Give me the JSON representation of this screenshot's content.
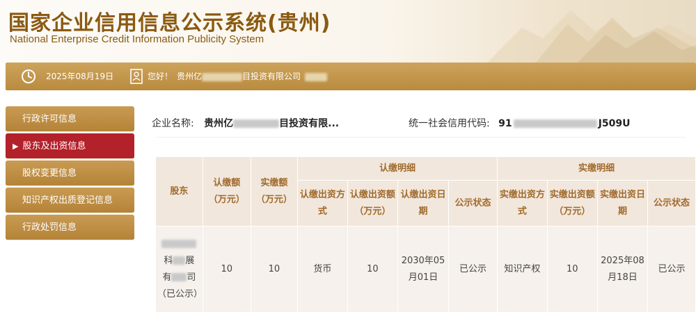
{
  "header": {
    "title_cn": "国家企业信用信息公示系统(贵州)",
    "title_en": "National Enterprise Credit Information Publicity System"
  },
  "infobar": {
    "date": "2025年08月19日",
    "greeting": "您好！",
    "company_prefix": "贵州亿",
    "company_suffix": "目投资有限公司"
  },
  "sidebar": {
    "items": [
      {
        "label": "行政许可信息",
        "active": false
      },
      {
        "label": "股东及出资信息",
        "active": true
      },
      {
        "label": "股权变更信息",
        "active": false
      },
      {
        "label": "知识产权出质登记信息",
        "active": false
      },
      {
        "label": "行政处罚信息",
        "active": false
      }
    ],
    "active_marker": "▶"
  },
  "enterprise": {
    "name_label": "企业名称:",
    "name_prefix": "贵州亿",
    "name_suffix": "目投资有限...",
    "code_label": "统一社会信用代码:",
    "code_prefix": "91",
    "code_suffix": "J509U"
  },
  "table": {
    "headers": {
      "shareholder": "股东",
      "subscribed_amount": "认缴额（万元）",
      "paid_amount": "实缴额（万元）",
      "subscribed_detail": "认缴明细",
      "paid_detail": "实缴明细",
      "sub_method": "认缴出资方式",
      "sub_amount": "认缴出资额（万元）",
      "sub_date": "认缴出资日期",
      "sub_status": "公示状态",
      "paid_method": "实缴出资方式",
      "paid_amt": "实缴出资额（万元）",
      "paid_date": "实缴出资日期",
      "paid_status": "公示状态"
    },
    "row": {
      "shareholder_a": "科",
      "shareholder_b": "展",
      "shareholder_c": "有",
      "shareholder_d": "司",
      "shareholder_note": "（已公示）",
      "subscribed_amount": "10",
      "paid_amount": "10",
      "sub_method": "货币",
      "sub_amount": "10",
      "sub_date": "2030年05月01日",
      "sub_status": "已公示",
      "paid_method": "知识产权",
      "paid_amt": "10",
      "paid_date": "2025年08月18日",
      "paid_status": "已公示"
    }
  },
  "icons": {
    "clock": "clock-icon",
    "user": "user-icon",
    "mountain": "mountain-decoration"
  },
  "colors": {
    "brand": "#8a5a12",
    "gold": "#c49650",
    "active": "#b3212b",
    "header_cell": "#f2e7dc",
    "data_cell": "#f6f1ec"
  }
}
